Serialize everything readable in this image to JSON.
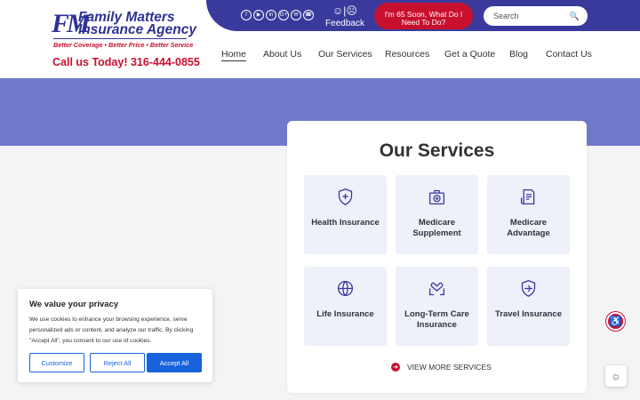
{
  "brand": {
    "mark": "FM",
    "name_line1": "Family Matters",
    "name_line2": "Insurance Agency",
    "tagline": "Better Coverage • Better Price • Better Service",
    "call": "Call us Today! 316-444-0855"
  },
  "topbar": {
    "social": [
      {
        "icon": "facebook-icon",
        "glyph": "f"
      },
      {
        "icon": "youtube-icon",
        "glyph": "▶"
      },
      {
        "icon": "linkedin-icon",
        "glyph": "in"
      },
      {
        "icon": "google-plus-icon",
        "glyph": "G+"
      },
      {
        "icon": "email-icon",
        "glyph": "✉"
      },
      {
        "icon": "phone-icon",
        "glyph": "☎"
      }
    ],
    "feedback_faces": "☺|☹",
    "feedback_label": "Feedback",
    "cta": "I'm 65 Soon, What Do I Need To Do?",
    "search_placeholder": "Search"
  },
  "nav": [
    "Home",
    "About Us",
    "Our Services",
    "Resources",
    "Get a Quote",
    "Blog",
    "Contact Us"
  ],
  "services": {
    "title": "Our Services",
    "items": [
      {
        "label": "Health Insurance",
        "icon": "health-shield-icon"
      },
      {
        "label": "Medicare Supplement",
        "icon": "medical-kit-icon"
      },
      {
        "label": "Medicare Advantage",
        "icon": "medical-document-icon"
      },
      {
        "label": "Life Insurance",
        "icon": "life-globe-icon"
      },
      {
        "label": "Long-Term Care Insurance",
        "icon": "care-hands-icon"
      },
      {
        "label": "Travel Insurance",
        "icon": "travel-shield-icon"
      }
    ],
    "more": "VIEW MORE SERVICES"
  },
  "cookie": {
    "title": "We value your privacy",
    "text": "We use cookies to enhance your browsing experience, serve personalized ads or content, and analyze our traffic. By clicking \"Accept All\", you consent to our use of cookies.",
    "customize": "Customize",
    "reject": "Reject All",
    "accept": "Accept All"
  },
  "colors": {
    "brand_blue": "#3a3a9c",
    "brand_red": "#c8102e",
    "hero": "#6f7acb",
    "tile": "#eef0fa"
  }
}
